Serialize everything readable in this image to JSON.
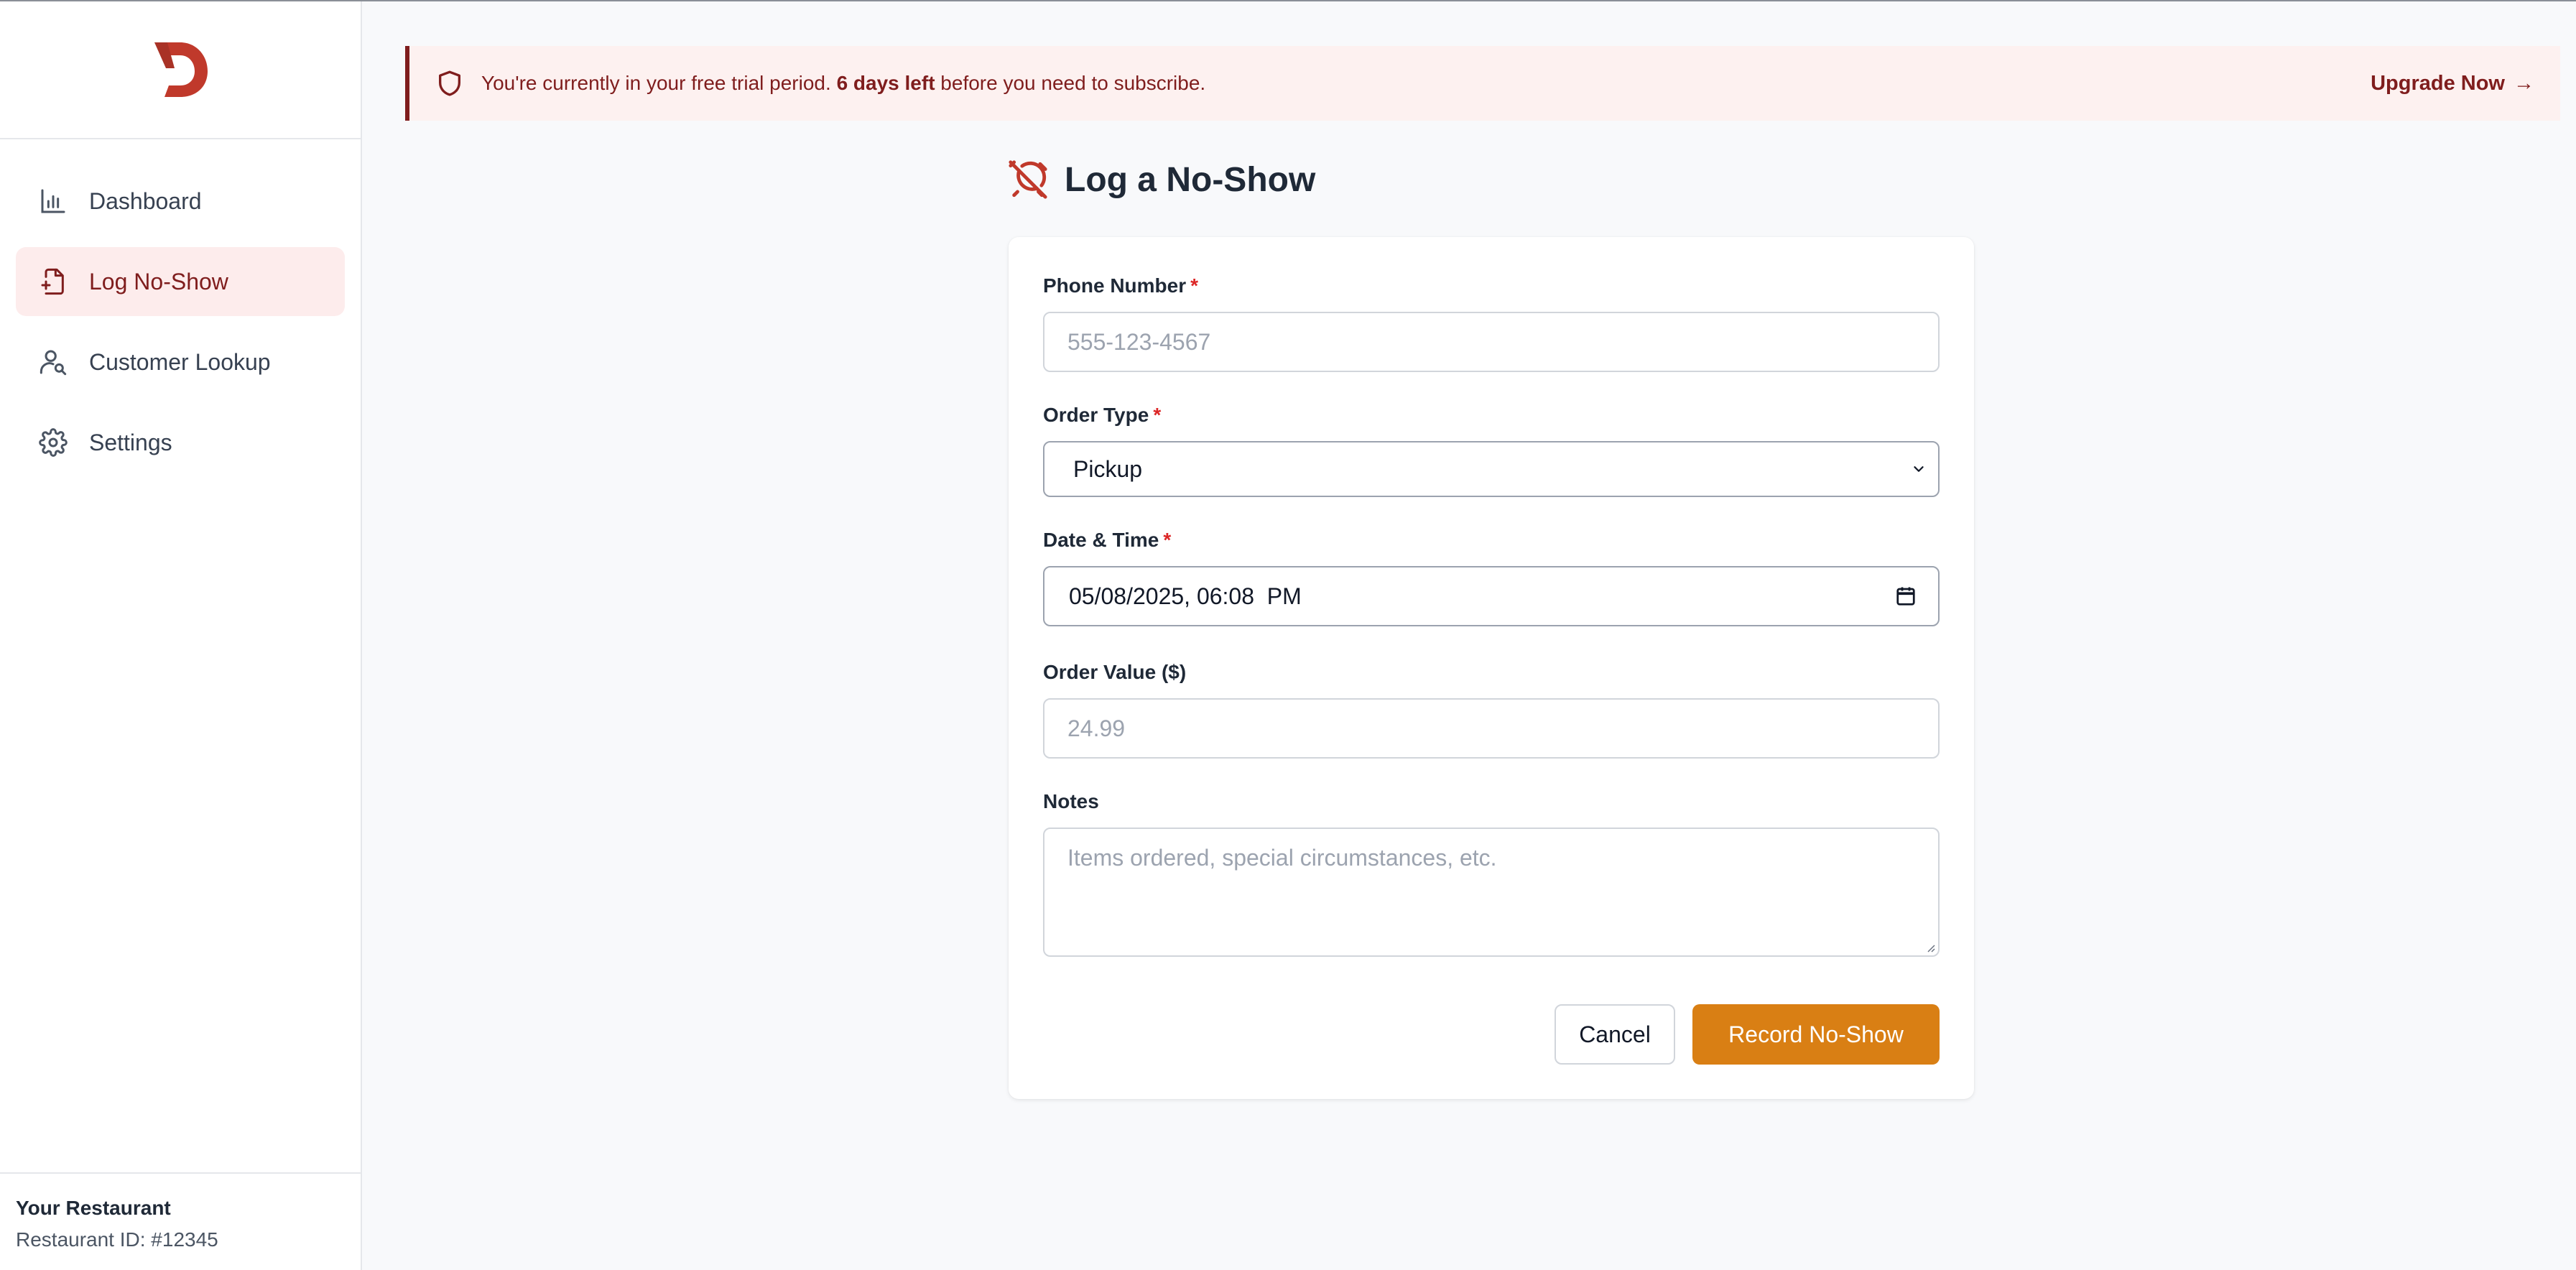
{
  "colors": {
    "brand": "#c0392b",
    "primary_button": "#d97f14",
    "banner_bg": "#fdf1f0",
    "banner_text": "#7f1d1d",
    "active_nav_bg": "#fdecec"
  },
  "sidebar": {
    "logo_icon": "d-logo-icon",
    "items": [
      {
        "label": "Dashboard",
        "icon": "bar-chart-icon",
        "active": false
      },
      {
        "label": "Log No-Show",
        "icon": "file-plus-icon",
        "active": true
      },
      {
        "label": "Customer Lookup",
        "icon": "user-search-icon",
        "active": false
      },
      {
        "label": "Settings",
        "icon": "gear-icon",
        "active": false
      }
    ],
    "footer": {
      "restaurant_name": "Your Restaurant",
      "restaurant_id": "Restaurant ID: #12345"
    }
  },
  "banner": {
    "icon": "shield-icon",
    "text_before": "You're currently in your free trial period.",
    "days_left": "6 days left",
    "text_after": "before you need to subscribe.",
    "upgrade_label": "Upgrade Now",
    "upgrade_arrow": "→"
  },
  "page": {
    "icon": "alarm-off-icon",
    "title": "Log a No-Show"
  },
  "form": {
    "phone": {
      "label": "Phone Number",
      "required_mark": "*",
      "placeholder": "555-123-4567"
    },
    "order_type": {
      "label": "Order Type",
      "required_mark": "*",
      "value": "Pickup"
    },
    "datetime": {
      "label": "Date & Time",
      "required_mark": "*",
      "value": "05/08/2025, 06:08  PM"
    },
    "order_value": {
      "label": "Order Value ($)",
      "placeholder": "24.99"
    },
    "notes": {
      "label": "Notes",
      "placeholder": "Items ordered, special circumstances, etc."
    },
    "cancel_label": "Cancel",
    "submit_label": "Record No-Show"
  }
}
